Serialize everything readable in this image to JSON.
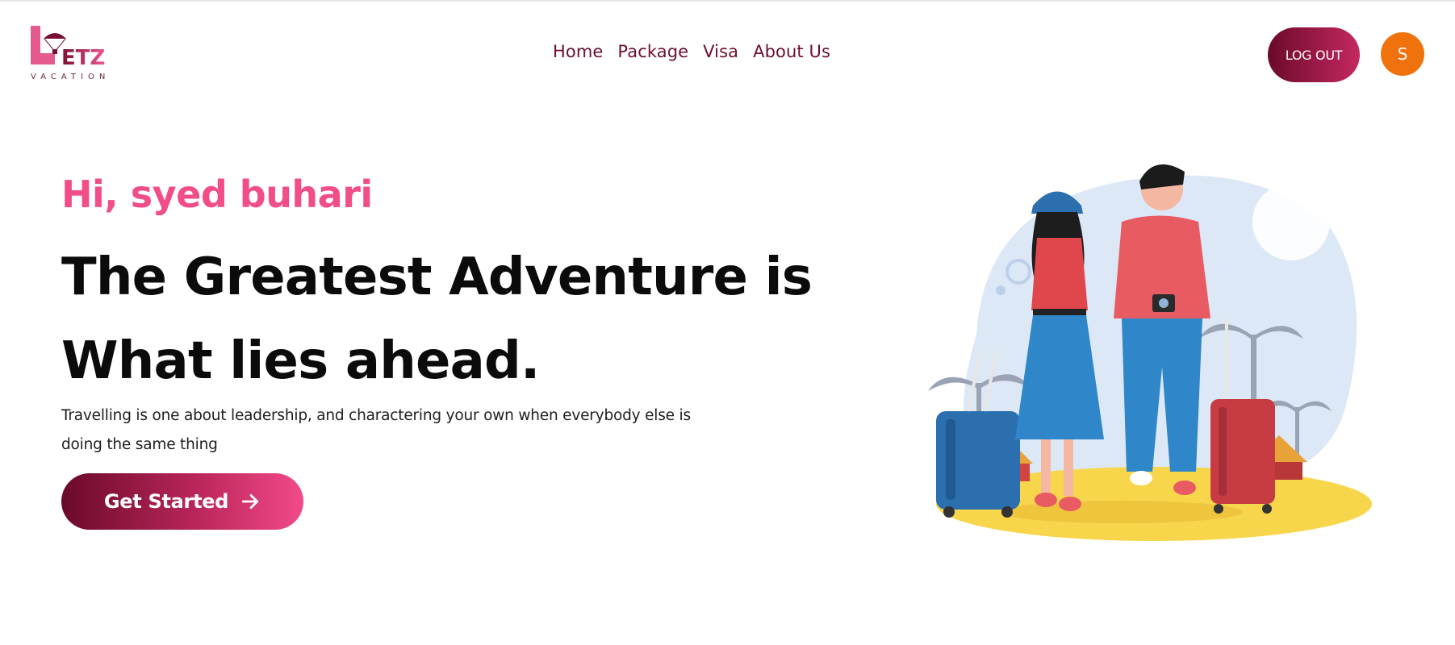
{
  "brand": {
    "logo_text": "ETZ",
    "logo_subtext": "VACATION",
    "logo_initial": "L"
  },
  "nav": {
    "items": [
      {
        "label": "Home"
      },
      {
        "label": "Package"
      },
      {
        "label": "Visa"
      },
      {
        "label": "About Us"
      }
    ]
  },
  "header": {
    "logout_label": "LOG OUT",
    "avatar_initial": "S"
  },
  "hero": {
    "greeting": "Hi, syed buhari",
    "headline_line1": "The Greatest Adventure is",
    "headline_line2": "What lies ahead.",
    "description": "Travelling is one about leadership, and charactering your own when everybody else is doing the same thing",
    "cta_label": "Get Started"
  },
  "colors": {
    "accent_pink": "#f14d89",
    "brand_maroon": "#6b0f2e",
    "avatar_orange": "#f0720c"
  }
}
